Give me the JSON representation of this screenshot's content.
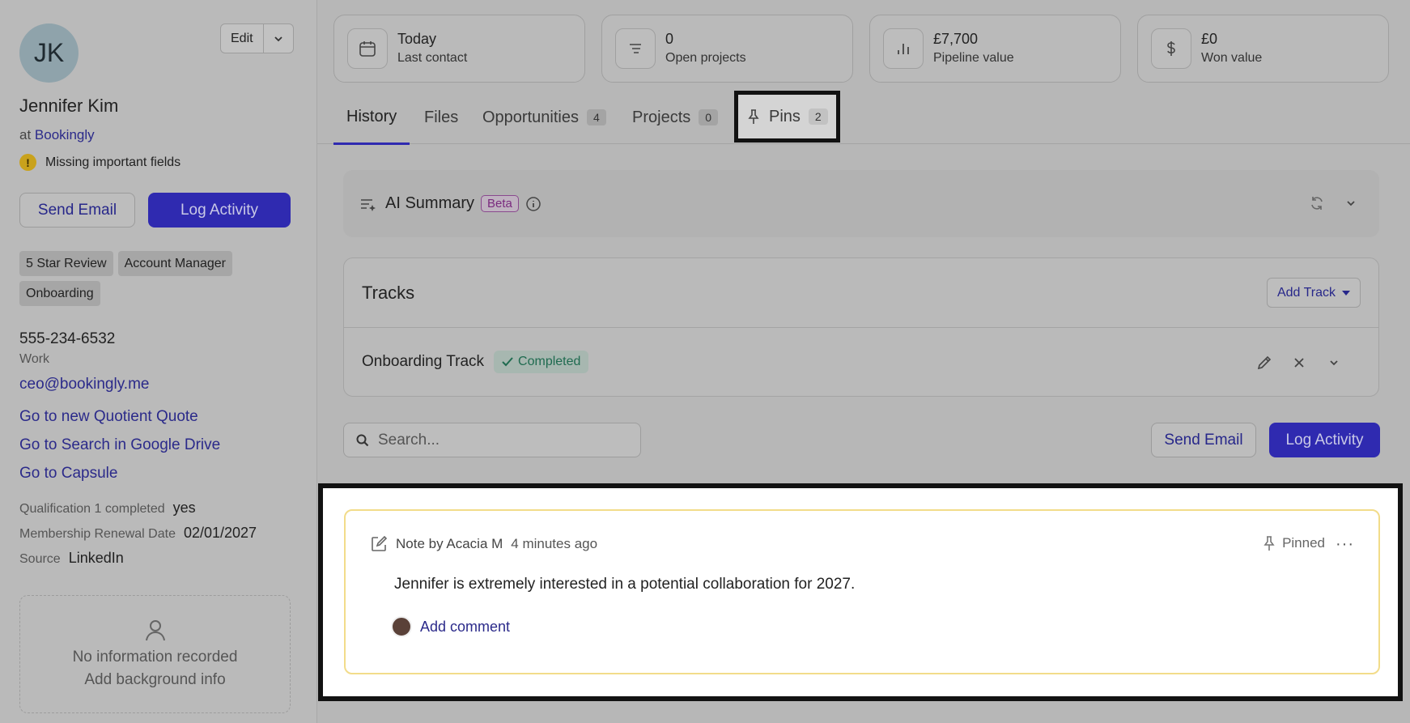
{
  "contact": {
    "initials": "JK",
    "name": "Jennifer Kim",
    "at_prefix": "at",
    "company": "Bookingly",
    "warning": "Missing important fields",
    "edit_label": "Edit",
    "send_email_label": "Send Email",
    "log_activity_label": "Log Activity",
    "tags": [
      "5 Star Review",
      "Account Manager",
      "Onboarding"
    ],
    "phone": "555-234-6532",
    "phone_type": "Work",
    "email": "ceo@bookingly.me",
    "links": [
      "Go to new Quotient Quote",
      "Go to Search in Google Drive",
      "Go to Capsule"
    ],
    "fields": [
      {
        "label": "Qualification 1 completed",
        "value": "yes"
      },
      {
        "label": "Membership Renewal Date",
        "value": "02/01/2027"
      },
      {
        "label": "Source",
        "value": "LinkedIn"
      }
    ],
    "background_empty": "No information recorded",
    "background_add": "Add background info"
  },
  "stats": [
    {
      "value": "Today",
      "label": "Last contact",
      "icon": "calendar-icon"
    },
    {
      "value": "0",
      "label": "Open projects",
      "icon": "list-icon"
    },
    {
      "value": "£7,700",
      "label": "Pipeline value",
      "icon": "bar-chart-icon"
    },
    {
      "value": "£0",
      "label": "Won value",
      "icon": "dollar-icon"
    }
  ],
  "tabs": [
    {
      "label": "History",
      "count": ""
    },
    {
      "label": "Files",
      "count": ""
    },
    {
      "label": "Opportunities",
      "count": "4"
    },
    {
      "label": "Projects",
      "count": "0"
    },
    {
      "label": "Pins",
      "count": "2"
    }
  ],
  "ai_summary": {
    "title": "AI Summary",
    "badge": "Beta"
  },
  "tracks": {
    "title": "Tracks",
    "add_label": "Add Track",
    "items": [
      {
        "name": "Onboarding Track",
        "status": "Completed"
      }
    ]
  },
  "history": {
    "search_placeholder": "Search...",
    "send_email_label": "Send Email",
    "log_activity_label": "Log Activity"
  },
  "note": {
    "author": "Note by Acacia M",
    "time": "4 minutes ago",
    "pinned_label": "Pinned",
    "more_label": "···",
    "body": "Jennifer is extremely interested in a potential collaboration for 2027.",
    "comment_label": "Add comment"
  },
  "colors": {
    "accent": "#2f2ab0",
    "link": "#2b2a8a",
    "note_border": "#f2dc8a",
    "completed": "#1f6b50"
  }
}
